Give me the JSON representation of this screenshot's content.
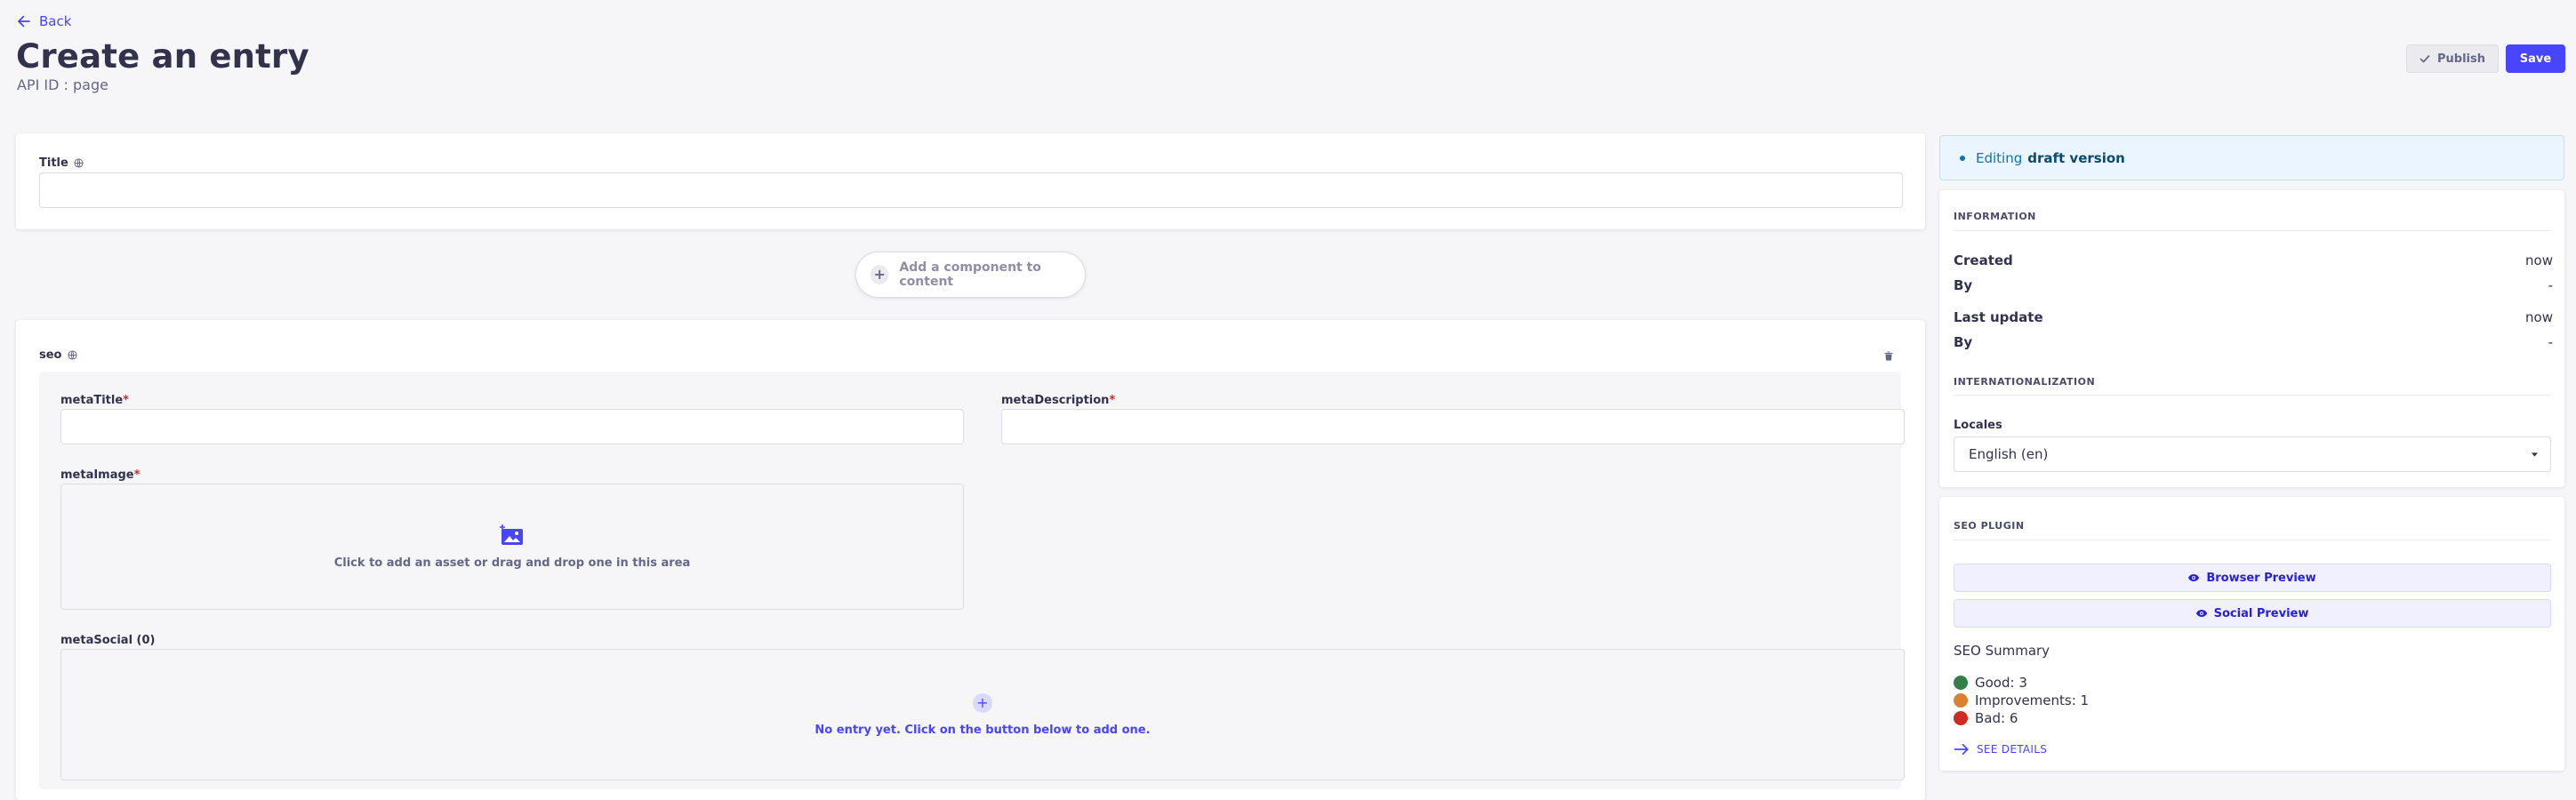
{
  "header": {
    "back_label": "Back",
    "title": "Create an entry",
    "api_id": "API ID : page",
    "publish_label": "Publish",
    "save_label": "Save"
  },
  "main": {
    "title_field": {
      "label": "Title",
      "value": ""
    },
    "add_component_label": "Add a component to content",
    "seo": {
      "label": "seo",
      "meta_title": {
        "label": "metaTitle",
        "required_mark": "*",
        "value": ""
      },
      "meta_description": {
        "label": "metaDescription",
        "required_mark": "*",
        "value": ""
      },
      "meta_image": {
        "label": "metaImage",
        "required_mark": "*",
        "drop_text": "Click to add an asset or drag and drop one in this area"
      },
      "meta_social": {
        "label": "metaSocial (0)",
        "empty_text": "No entry yet. Click on the button below to add one."
      }
    }
  },
  "sidebar": {
    "draft": {
      "prefix": "Editing",
      "highlight": "draft version"
    },
    "information": {
      "title": "INFORMATION",
      "created_label": "Created",
      "created_value": "now",
      "created_by_label": "By",
      "created_by_value": "-",
      "updated_label": "Last update",
      "updated_value": "now",
      "updated_by_label": "By",
      "updated_by_value": "-"
    },
    "i18n": {
      "title": "INTERNATIONALIZATION",
      "locales_label": "Locales",
      "selected_locale": "English (en)"
    },
    "seo_plugin": {
      "title": "SEO PLUGIN",
      "browser_preview": "Browser Preview",
      "social_preview": "Social Preview",
      "summary_title": "SEO Summary",
      "good": "Good: 3",
      "improvements": "Improvements: 1",
      "bad": "Bad: 6",
      "see_details": "SEE DETAILS"
    }
  },
  "colors": {
    "primary": "#4945ff",
    "good": "#328048",
    "improvements": "#d9822f",
    "bad": "#d02b20",
    "draft_bg": "#eaf5ff"
  }
}
